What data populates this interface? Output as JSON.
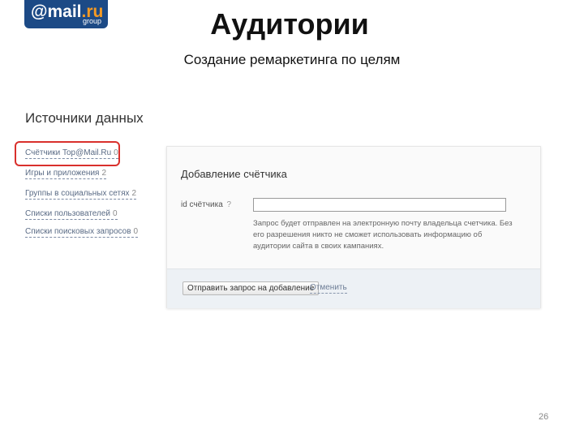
{
  "logo": {
    "at": "@mail",
    "ru": ".ru",
    "group": "group"
  },
  "title": "Аудитории",
  "subtitle": "Создание ремаркетинга по целям",
  "sources": {
    "heading": "Источники данных",
    "items": [
      {
        "label": "Счётчики Top@Mail.Ru",
        "count": "0"
      },
      {
        "label": "Игры и приложения",
        "count": "2"
      },
      {
        "label": "Группы в социальных сетях",
        "count": "2"
      },
      {
        "label": "Списки пользователей",
        "count": "0"
      },
      {
        "label": "Списки поисковых запросов",
        "count": "0"
      }
    ]
  },
  "panel": {
    "title": "Добавление счётчика",
    "id_label": "id счётчика",
    "id_hint": "?",
    "id_value": "",
    "note": "Запрос будет отправлен на электронную почту владельца счетчика. Без его разрешения никто не сможет использовать информацию об аудитории сайта в своих кампаниях.",
    "send_button": "Отправить запрос на добавление",
    "cancel": "Отменить"
  },
  "page_number": "26",
  "colors": {
    "brand": "#1c4a86",
    "brand_accent": "#f59a23",
    "highlight": "#d9302c",
    "link": "#5a6b85"
  }
}
